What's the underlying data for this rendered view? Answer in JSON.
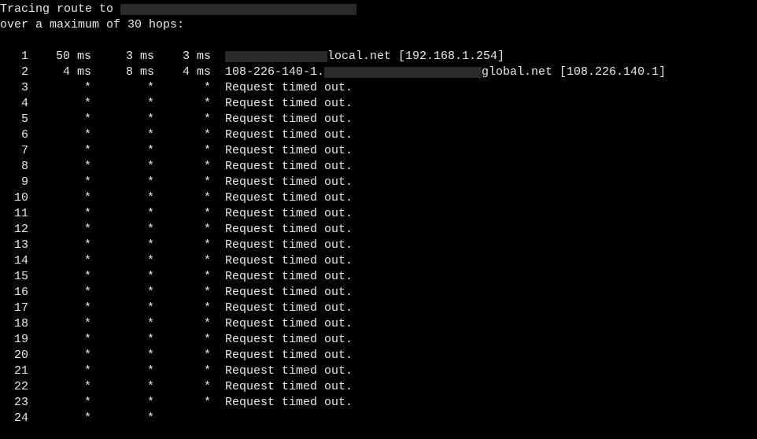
{
  "header": {
    "line1_prefix": "Tracing route to ",
    "line2": "over a maximum of 30 hops:"
  },
  "hops": [
    {
      "n": "1",
      "t1": "50 ms",
      "t2": "3 ms",
      "t3": "3 ms",
      "dest_pre": "",
      "redact": true,
      "dest_post": "local.net [192.168.1.254]"
    },
    {
      "n": "2",
      "t1": "4 ms",
      "t2": "8 ms",
      "t3": "4 ms",
      "dest_pre": "108-226-140-1.",
      "redact": true,
      "dest_post": "global.net [108.226.140.1]"
    },
    {
      "n": "3",
      "t1": "*",
      "t2": "*",
      "t3": "*",
      "dest_pre": "Request timed out.",
      "redact": false,
      "dest_post": ""
    },
    {
      "n": "4",
      "t1": "*",
      "t2": "*",
      "t3": "*",
      "dest_pre": "Request timed out.",
      "redact": false,
      "dest_post": ""
    },
    {
      "n": "5",
      "t1": "*",
      "t2": "*",
      "t3": "*",
      "dest_pre": "Request timed out.",
      "redact": false,
      "dest_post": ""
    },
    {
      "n": "6",
      "t1": "*",
      "t2": "*",
      "t3": "*",
      "dest_pre": "Request timed out.",
      "redact": false,
      "dest_post": ""
    },
    {
      "n": "7",
      "t1": "*",
      "t2": "*",
      "t3": "*",
      "dest_pre": "Request timed out.",
      "redact": false,
      "dest_post": ""
    },
    {
      "n": "8",
      "t1": "*",
      "t2": "*",
      "t3": "*",
      "dest_pre": "Request timed out.",
      "redact": false,
      "dest_post": ""
    },
    {
      "n": "9",
      "t1": "*",
      "t2": "*",
      "t3": "*",
      "dest_pre": "Request timed out.",
      "redact": false,
      "dest_post": ""
    },
    {
      "n": "10",
      "t1": "*",
      "t2": "*",
      "t3": "*",
      "dest_pre": "Request timed out.",
      "redact": false,
      "dest_post": ""
    },
    {
      "n": "11",
      "t1": "*",
      "t2": "*",
      "t3": "*",
      "dest_pre": "Request timed out.",
      "redact": false,
      "dest_post": ""
    },
    {
      "n": "12",
      "t1": "*",
      "t2": "*",
      "t3": "*",
      "dest_pre": "Request timed out.",
      "redact": false,
      "dest_post": ""
    },
    {
      "n": "13",
      "t1": "*",
      "t2": "*",
      "t3": "*",
      "dest_pre": "Request timed out.",
      "redact": false,
      "dest_post": ""
    },
    {
      "n": "14",
      "t1": "*",
      "t2": "*",
      "t3": "*",
      "dest_pre": "Request timed out.",
      "redact": false,
      "dest_post": ""
    },
    {
      "n": "15",
      "t1": "*",
      "t2": "*",
      "t3": "*",
      "dest_pre": "Request timed out.",
      "redact": false,
      "dest_post": ""
    },
    {
      "n": "16",
      "t1": "*",
      "t2": "*",
      "t3": "*",
      "dest_pre": "Request timed out.",
      "redact": false,
      "dest_post": ""
    },
    {
      "n": "17",
      "t1": "*",
      "t2": "*",
      "t3": "*",
      "dest_pre": "Request timed out.",
      "redact": false,
      "dest_post": ""
    },
    {
      "n": "18",
      "t1": "*",
      "t2": "*",
      "t3": "*",
      "dest_pre": "Request timed out.",
      "redact": false,
      "dest_post": ""
    },
    {
      "n": "19",
      "t1": "*",
      "t2": "*",
      "t3": "*",
      "dest_pre": "Request timed out.",
      "redact": false,
      "dest_post": ""
    },
    {
      "n": "20",
      "t1": "*",
      "t2": "*",
      "t3": "*",
      "dest_pre": "Request timed out.",
      "redact": false,
      "dest_post": ""
    },
    {
      "n": "21",
      "t1": "*",
      "t2": "*",
      "t3": "*",
      "dest_pre": "Request timed out.",
      "redact": false,
      "dest_post": ""
    },
    {
      "n": "22",
      "t1": "*",
      "t2": "*",
      "t3": "*",
      "dest_pre": "Request timed out.",
      "redact": false,
      "dest_post": ""
    },
    {
      "n": "23",
      "t1": "*",
      "t2": "*",
      "t3": "*",
      "dest_pre": "Request timed out.",
      "redact": false,
      "dest_post": ""
    },
    {
      "n": "24",
      "t1": "*",
      "t2": "*",
      "t3": "",
      "dest_pre": "",
      "redact": false,
      "dest_post": ""
    }
  ]
}
